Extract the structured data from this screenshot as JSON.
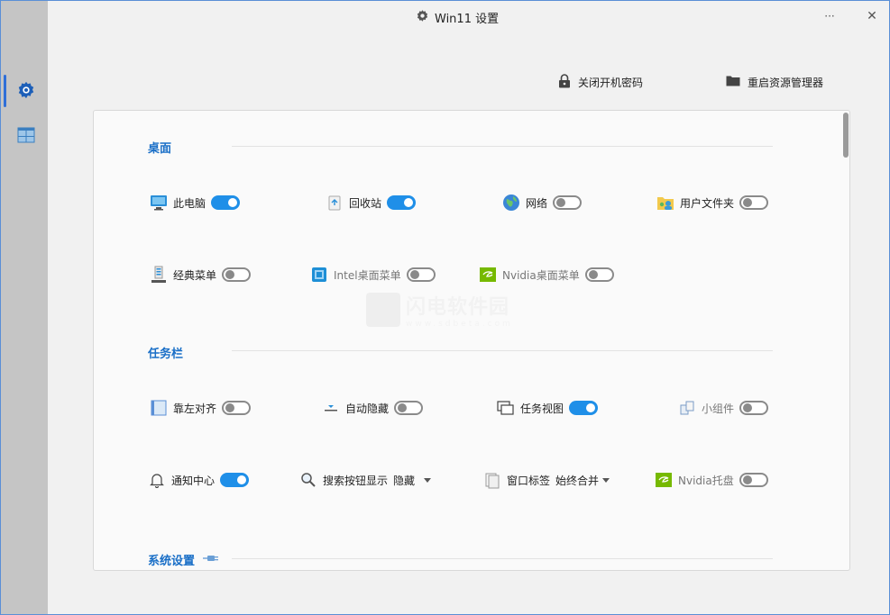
{
  "window": {
    "title": "Win11 设置",
    "more_glyph": "···",
    "close_glyph": "✕"
  },
  "sidebar": {
    "items": [
      {
        "icon": "gear-icon",
        "active": true
      },
      {
        "icon": "grid-window-icon",
        "active": false
      }
    ]
  },
  "top_actions": {
    "disable_password": "关闭开机密码",
    "restart_explorer": "重启资源管理器"
  },
  "watermark": {
    "text": "闪电软件园",
    "sub": "www.sdbeta.com"
  },
  "sections": {
    "desktop": {
      "title": "桌面",
      "items": [
        {
          "label": "此电脑",
          "on": true
        },
        {
          "label": "回收站",
          "on": true
        },
        {
          "label": "网络",
          "on": false
        },
        {
          "label": "用户文件夹",
          "on": false
        },
        {
          "label": "经典菜单",
          "on": false
        },
        {
          "label": "Intel桌面菜单",
          "on": false
        },
        {
          "label": "Nvidia桌面菜单",
          "on": false
        }
      ]
    },
    "taskbar": {
      "title": "任务栏",
      "items": [
        {
          "label": "靠左对齐",
          "on": false
        },
        {
          "label": "自动隐藏",
          "on": false
        },
        {
          "label": "任务视图",
          "on": true
        },
        {
          "label": "小组件",
          "on": false
        },
        {
          "label": "通知中心",
          "on": true
        },
        {
          "label": "搜索按钮显示",
          "value": "隐藏"
        },
        {
          "label": "窗口标签",
          "value": "始终合并"
        },
        {
          "label": "Nvidia托盘",
          "on": false
        }
      ]
    },
    "system": {
      "title": "系统设置"
    }
  },
  "colors": {
    "accent": "#1f8fe8",
    "section_title": "#1a6fc7",
    "sidebar": "#c5c5c5"
  }
}
